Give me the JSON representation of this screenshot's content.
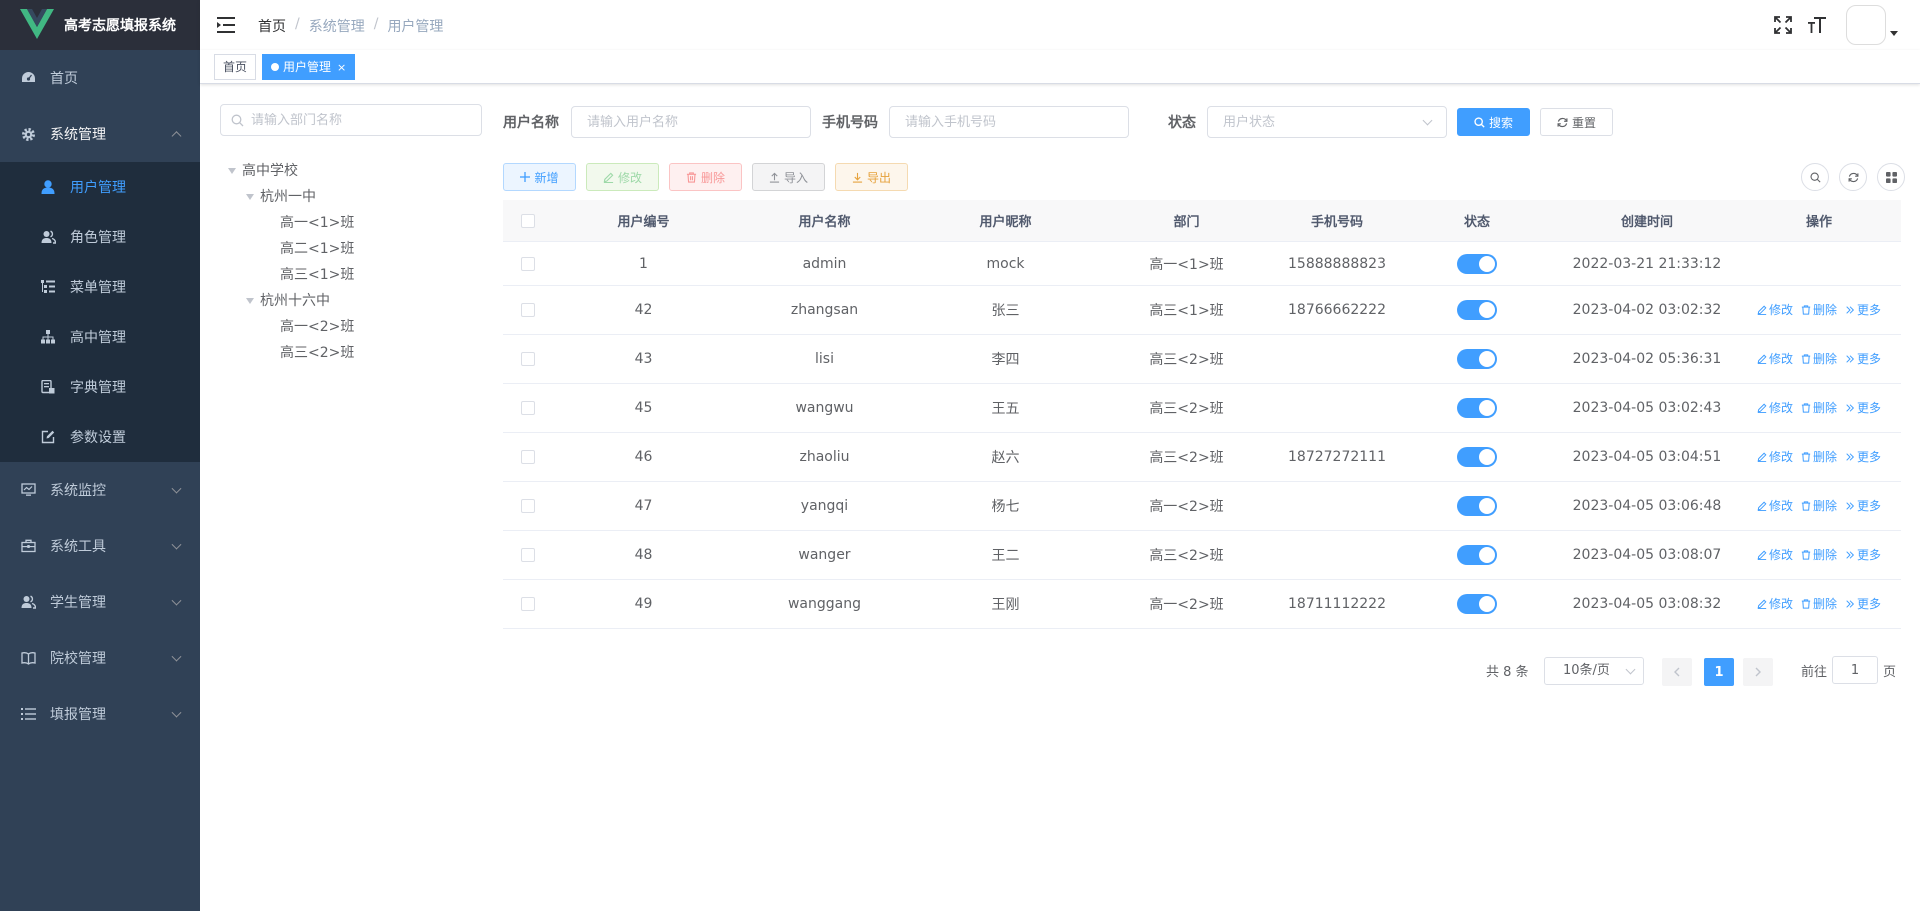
{
  "app": {
    "title": "高考志愿填报系统"
  },
  "sidebar": {
    "items": [
      {
        "label": "首页",
        "icon": "dashboard-icon"
      },
      {
        "label": "系统管理",
        "icon": "gear-icon",
        "open": true,
        "children": [
          {
            "label": "用户管理",
            "icon": "user-icon",
            "active": true
          },
          {
            "label": "角色管理",
            "icon": "peoples-icon"
          },
          {
            "label": "菜单管理",
            "icon": "tree-table-icon"
          },
          {
            "label": "高中管理",
            "icon": "tree-icon"
          },
          {
            "label": "字典管理",
            "icon": "dict-icon"
          },
          {
            "label": "参数设置",
            "icon": "edit-icon"
          }
        ]
      },
      {
        "label": "系统监控",
        "icon": "monitor-icon"
      },
      {
        "label": "系统工具",
        "icon": "tool-icon"
      },
      {
        "label": "学生管理",
        "icon": "peoples-icon"
      },
      {
        "label": "院校管理",
        "icon": "book-icon"
      },
      {
        "label": "填报管理",
        "icon": "list-icon"
      }
    ]
  },
  "navbar": {
    "breadcrumb": [
      "首页",
      "系统管理",
      "用户管理"
    ]
  },
  "tags": {
    "home": "首页",
    "current": "用户管理",
    "close": "×"
  },
  "dept": {
    "placeholder": "请输入部门名称",
    "tree": {
      "root": "高中学校",
      "school1": "杭州一中",
      "s1c1": "高一<1>班",
      "s1c2": "高二<1>班",
      "s1c3": "高三<1>班",
      "school2": "杭州十六中",
      "s2c1": "高一<2>班",
      "s2c2": "高三<2>班"
    }
  },
  "query": {
    "username_label": "用户名称",
    "username_placeholder": "请输入用户名称",
    "phone_label": "手机号码",
    "phone_placeholder": "请输入手机号码",
    "status_label": "状态",
    "status_placeholder": "用户状态",
    "search_label": "搜索",
    "reset_label": "重置"
  },
  "toolbar": {
    "add": "新增",
    "edit": "修改",
    "delete": "删除",
    "import": "导入",
    "export": "导出"
  },
  "table": {
    "headers": [
      "用户编号",
      "用户名称",
      "用户昵称",
      "部门",
      "手机号码",
      "状态",
      "创建时间",
      "操作"
    ],
    "actions": {
      "edit": "修改",
      "delete": "删除",
      "more": "更多"
    },
    "rows": [
      {
        "id": "1",
        "username": "admin",
        "nickname": "mock",
        "dept": "高一<1>班",
        "phone": "15888888823",
        "status": true,
        "created": "2022-03-21 21:33:12",
        "ops": false
      },
      {
        "id": "42",
        "username": "zhangsan",
        "nickname": "张三",
        "dept": "高三<1>班",
        "phone": "18766662222",
        "status": true,
        "created": "2023-04-02 03:02:32",
        "ops": true
      },
      {
        "id": "43",
        "username": "lisi",
        "nickname": "李四",
        "dept": "高三<2>班",
        "phone": "",
        "status": true,
        "created": "2023-04-02 05:36:31",
        "ops": true
      },
      {
        "id": "45",
        "username": "wangwu",
        "nickname": "王五",
        "dept": "高三<2>班",
        "phone": "",
        "status": true,
        "created": "2023-04-05 03:02:43",
        "ops": true
      },
      {
        "id": "46",
        "username": "zhaoliu",
        "nickname": "赵六",
        "dept": "高三<2>班",
        "phone": "18727272111",
        "status": true,
        "created": "2023-04-05 03:04:51",
        "ops": true
      },
      {
        "id": "47",
        "username": "yangqi",
        "nickname": "杨七",
        "dept": "高一<2>班",
        "phone": "",
        "status": true,
        "created": "2023-04-05 03:06:48",
        "ops": true
      },
      {
        "id": "48",
        "username": "wanger",
        "nickname": "王二",
        "dept": "高三<2>班",
        "phone": "",
        "status": true,
        "created": "2023-04-05 03:08:07",
        "ops": true
      },
      {
        "id": "49",
        "username": "wanggang",
        "nickname": "王刚",
        "dept": "高一<2>班",
        "phone": "18711112222",
        "status": true,
        "created": "2023-04-05 03:08:32",
        "ops": true
      }
    ]
  },
  "pagination": {
    "total": "共 8 条",
    "page_size": "10条/页",
    "current_page": "1",
    "goto_label": "前往",
    "goto_value": "1",
    "page_suffix": "页"
  },
  "colors": {
    "sidebar_bg": "#304156",
    "submenu_bg": "#1f2d3d",
    "primary": "#409eff"
  }
}
